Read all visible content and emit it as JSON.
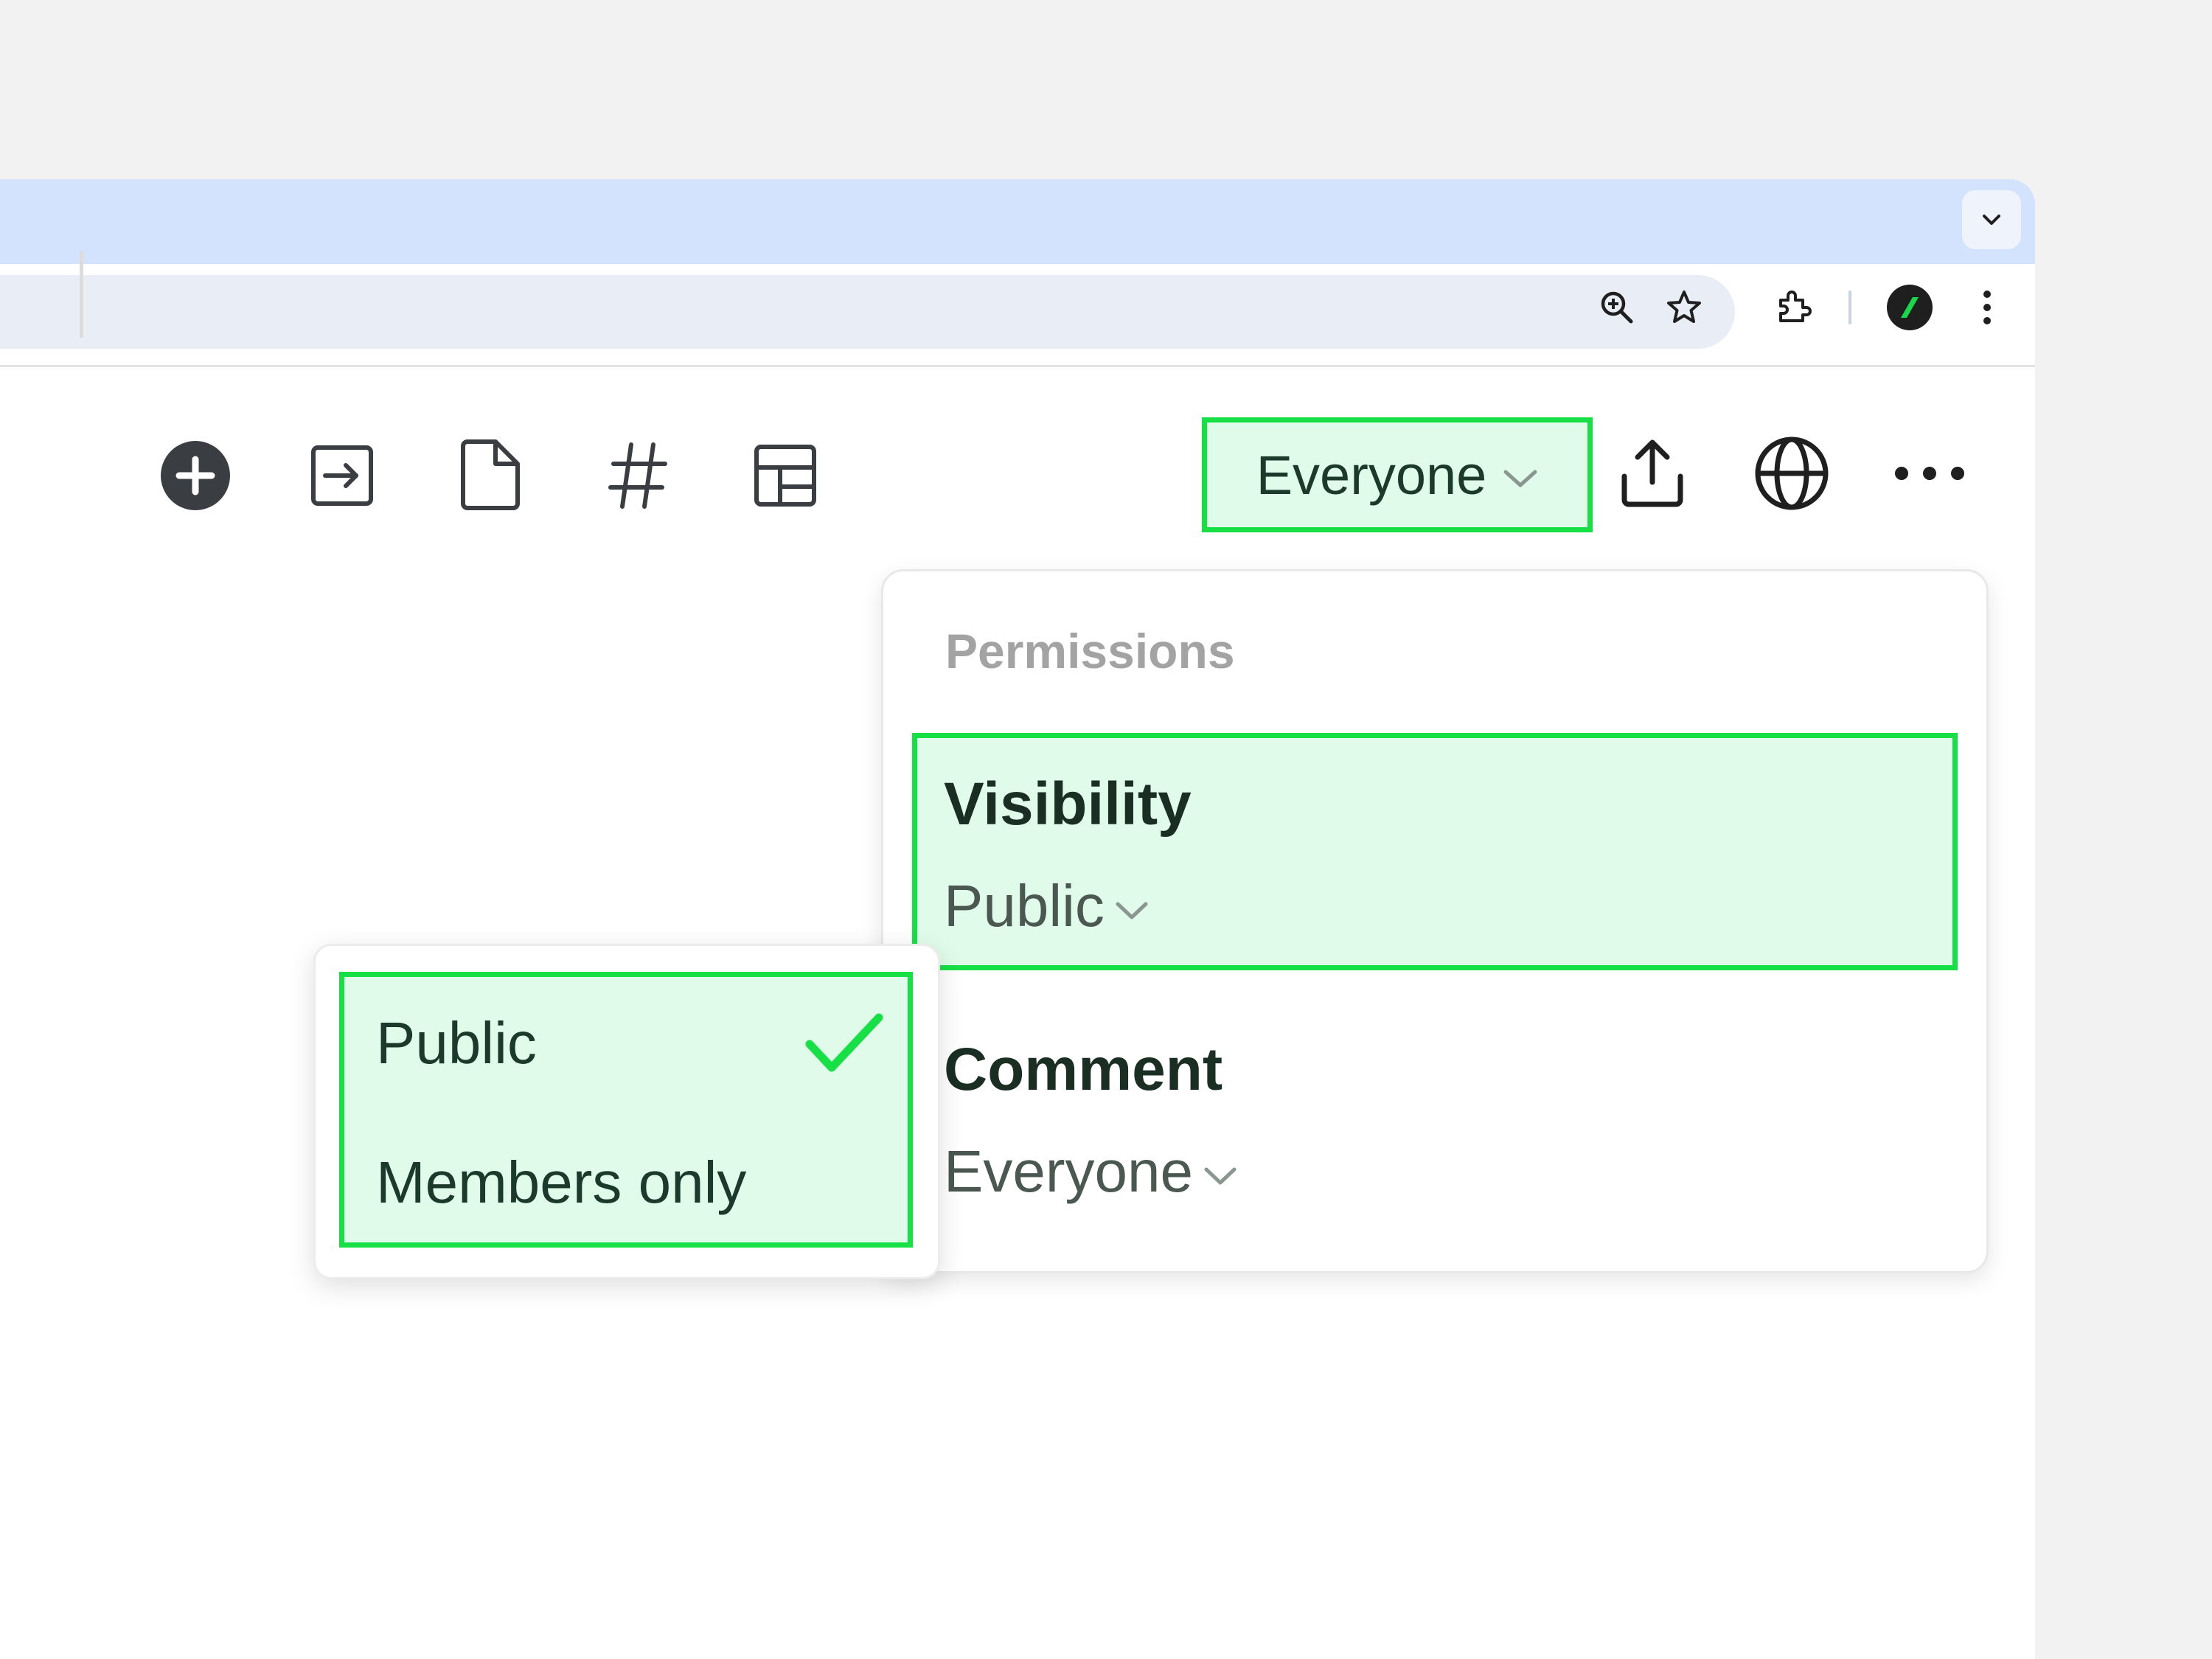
{
  "browser": {
    "tab_search_icon": "chevron-down-icon",
    "toolbar_icons": [
      "zoom-icon",
      "star-icon",
      "extensions-icon",
      "profile-icon",
      "kebab-menu-icon"
    ]
  },
  "app_toolbar": {
    "icons": [
      "add-circle-icon",
      "move-to-icon",
      "page-icon",
      "hashtag-icon",
      "layout-icon"
    ],
    "everyone_label": "Everyone",
    "right_icons": [
      "share-upload-icon",
      "globe-icon",
      "more-icon"
    ]
  },
  "permissions": {
    "title": "Permissions",
    "visibility": {
      "label": "Visibility",
      "value": "Public"
    },
    "comment": {
      "label": "Comment",
      "value": "Everyone"
    }
  },
  "visibility_menu": {
    "options": [
      {
        "label": "Public",
        "selected": true
      },
      {
        "label": "Members only",
        "selected": false
      }
    ]
  },
  "colors": {
    "highlight_border": "#17e046",
    "highlight_fill": "#e1fbeb",
    "tabstrip": "#d3e3fd",
    "omnibox": "#e9eef6"
  }
}
